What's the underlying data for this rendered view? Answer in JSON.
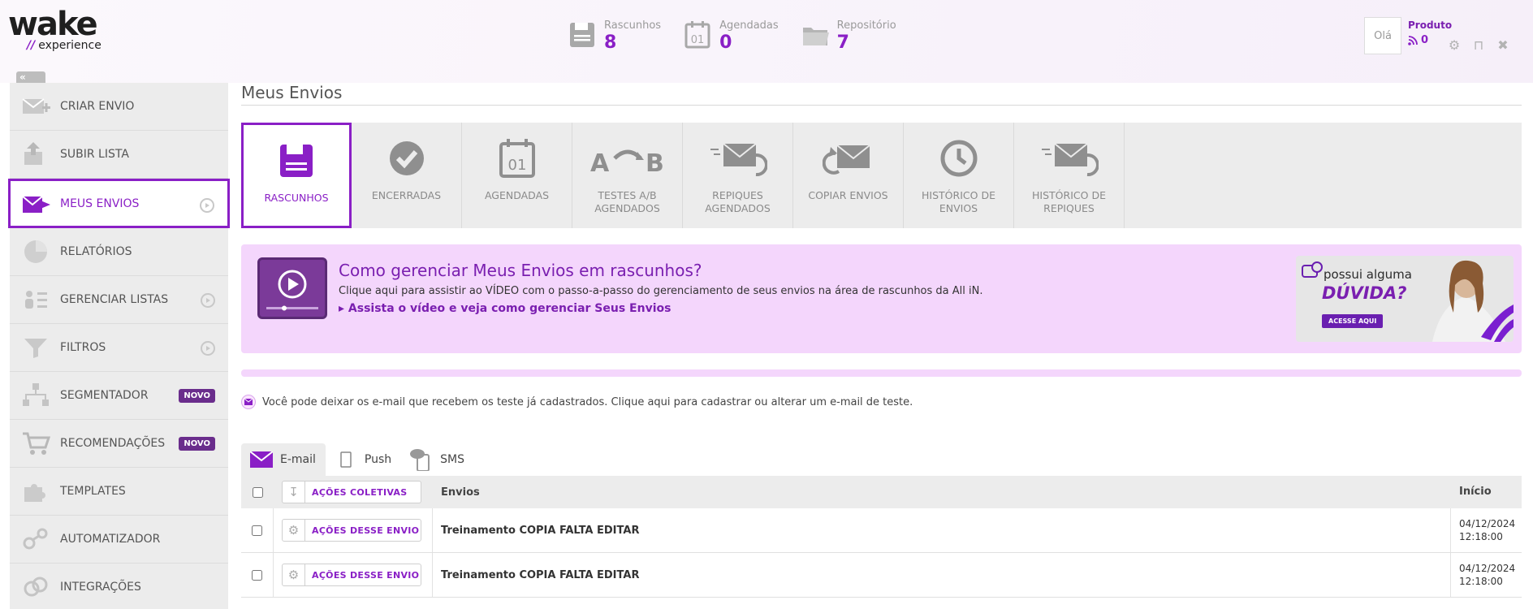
{
  "brand": {
    "logo_word": "wake",
    "logo_prefix": "//",
    "logo_sub": "experience",
    "accent": "#8a1fc6"
  },
  "stats": [
    {
      "label": "Rascunhos",
      "value": "8",
      "icon": "floppy-icon"
    },
    {
      "label": "Agendadas",
      "value": "0",
      "icon": "calendar-icon"
    },
    {
      "label": "Repositório",
      "value": "7",
      "icon": "folder-icon"
    }
  ],
  "user": {
    "greeting": "Olá",
    "name": "Produto",
    "feed_count": "0"
  },
  "sidebar": {
    "collapse": "«",
    "items": [
      {
        "label": "CRIAR ENVIO"
      },
      {
        "label": "SUBIR LISTA"
      },
      {
        "label": "MEUS ENVIOS"
      },
      {
        "label": "RELATÓRIOS"
      },
      {
        "label": "GERENCIAR LISTAS"
      },
      {
        "label": "FILTROS"
      },
      {
        "label": "SEGMENTADOR",
        "badge": "NOVO"
      },
      {
        "label": "RECOMENDAÇÕES",
        "badge": "NOVO"
      },
      {
        "label": "TEMPLATES"
      },
      {
        "label": "AUTOMATIZADOR"
      },
      {
        "label": "INTEGRAÇÕES"
      }
    ]
  },
  "page": {
    "title": "Meus Envios"
  },
  "tabs": [
    {
      "l1": "RASCUNHOS",
      "l2": ""
    },
    {
      "l1": "ENCERRADAS",
      "l2": ""
    },
    {
      "l1": "AGENDADAS",
      "l2": ""
    },
    {
      "l1": "TESTES A/B",
      "l2": "AGENDADOS"
    },
    {
      "l1": "REPIQUES",
      "l2": "AGENDADOS"
    },
    {
      "l1": "COPIAR ENVIOS",
      "l2": ""
    },
    {
      "l1": "HISTÓRICO DE",
      "l2": "ENVIOS"
    },
    {
      "l1": "HISTÓRICO DE",
      "l2": "REPIQUES"
    }
  ],
  "banner": {
    "title": "Como gerenciar Meus Envios em rascunhos?",
    "desc": "Clique aqui para assistir ao VÍDEO com o passo-a-passo do gerenciamento de seus envios na área de rascunhos da All iN.",
    "link": "Assista o vídeo e veja como gerenciar Seus Envios",
    "ad_line1": "possui alguma",
    "ad_line2": "DÚVIDA?",
    "ad_button": "ACESSE AQUI"
  },
  "note": "Você pode deixar os e-mail que recebem os teste já cadastrados. Clique aqui para cadastrar ou alterar um e-mail de teste.",
  "channels": [
    {
      "label": "E-mail"
    },
    {
      "label": "Push"
    },
    {
      "label": "SMS"
    }
  ],
  "table": {
    "bulk_action": "AÇÕES COLETIVAS",
    "col_envios": "Envios",
    "col_inicio": "Início",
    "rows": [
      {
        "action": "AÇÕES DESSE ENVIO",
        "name": "Treinamento COPIA FALTA EDITAR",
        "date": "04/12/2024",
        "time": "12:18:00"
      },
      {
        "action": "AÇÕES DESSE ENVIO",
        "name": "Treinamento COPIA FALTA EDITAR",
        "date": "04/12/2024",
        "time": "12:18:00"
      }
    ]
  }
}
